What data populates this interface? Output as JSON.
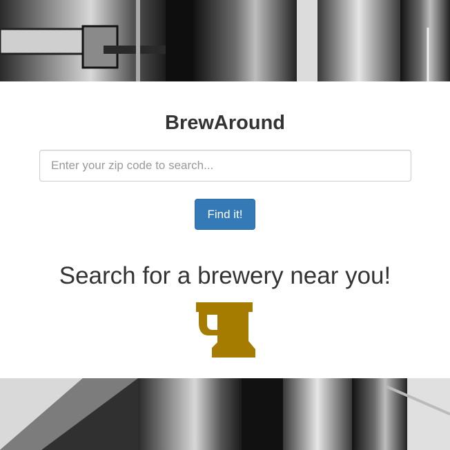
{
  "app": {
    "title": "BrewAround"
  },
  "search": {
    "placeholder": "Enter your zip code to search...",
    "value": "",
    "button_label": "Find it!"
  },
  "hero": {
    "tagline": "Search for a brewery near you!",
    "icon": "beer-mug-icon",
    "icon_color": "#a67c00"
  },
  "colors": {
    "button": "#337ab7",
    "panel": "#ffffff",
    "text": "#333333"
  }
}
